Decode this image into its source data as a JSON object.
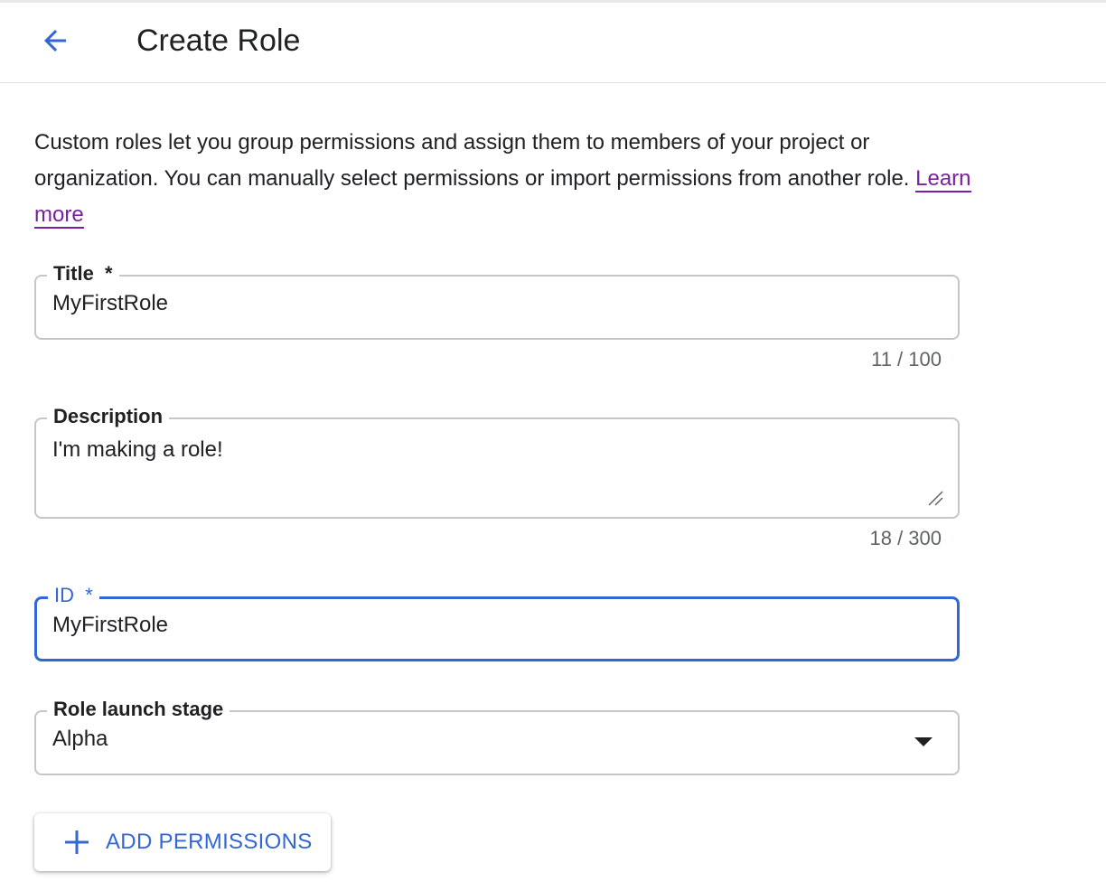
{
  "header": {
    "back_icon": "arrow-back-icon",
    "title": "Create Role"
  },
  "intro": {
    "text": "Custom roles let you group permissions and assign them to members of your project or organization. You can manually select permissions or import permissions from another role. ",
    "link_label": "Learn more"
  },
  "form": {
    "title": {
      "label": "Title  *",
      "value": "MyFirstRole",
      "counter": "11 / 100"
    },
    "description": {
      "label": "Description",
      "value": "I'm making a role!",
      "counter": "18 / 300"
    },
    "id": {
      "label": "ID  *",
      "value": "MyFirstRole"
    },
    "launch_stage": {
      "label": "Role launch stage",
      "value": "Alpha"
    }
  },
  "actions": {
    "add_permissions_label": "ADD PERMISSIONS"
  },
  "colors": {
    "accent": "#3367d6",
    "link": "#7b1fa2",
    "border": "#c4c7c5"
  }
}
